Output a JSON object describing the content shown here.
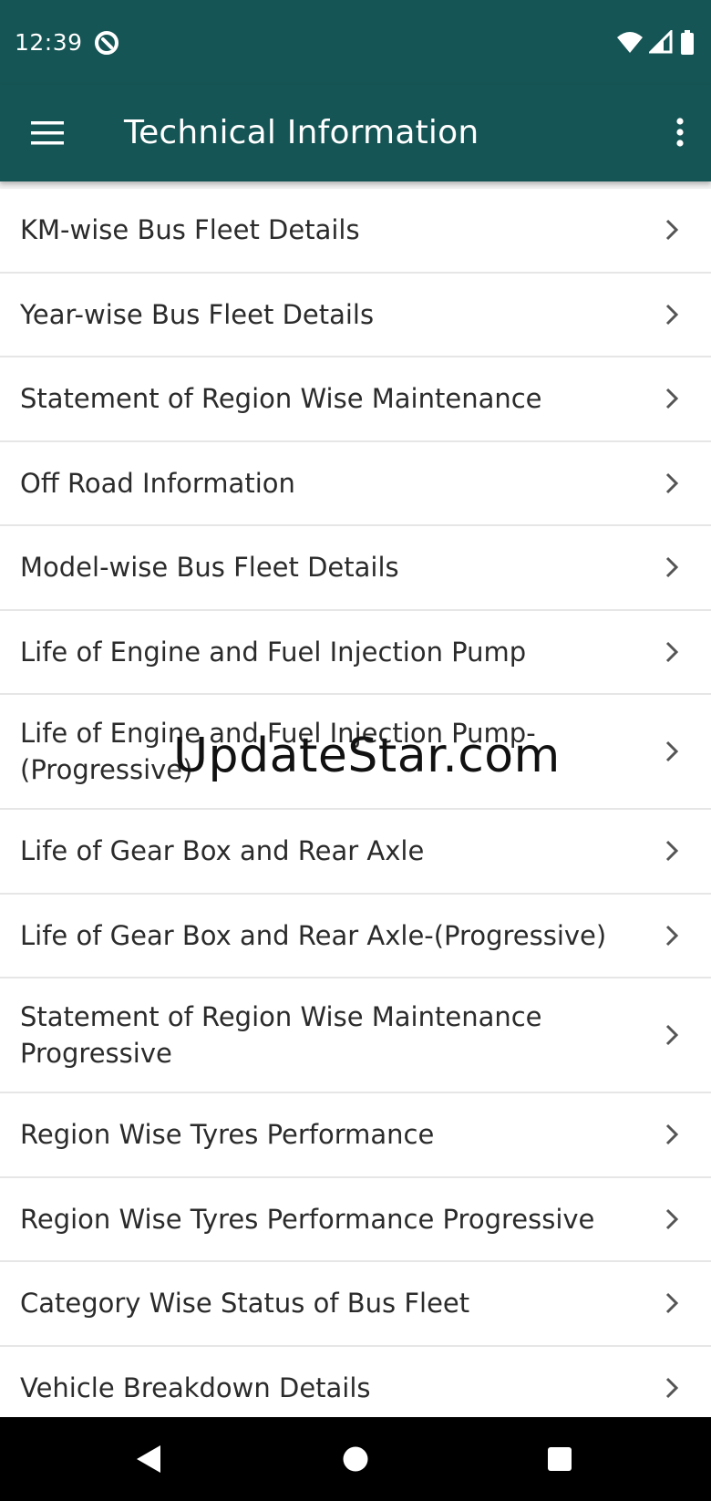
{
  "status_bar": {
    "time": "12:39",
    "app_icon": "app-notification-icon",
    "icons": [
      "wifi-icon",
      "cell-signal-icon",
      "battery-icon"
    ]
  },
  "app_bar": {
    "title": "Technical Information",
    "menu_icon": "hamburger-menu-icon",
    "overflow_icon": "more-vert-icon",
    "background_color": "#165555"
  },
  "list": {
    "items": [
      {
        "label": "KM-wise Bus Fleet Details"
      },
      {
        "label": "Year-wise Bus Fleet Details"
      },
      {
        "label": "Statement of Region Wise Maintenance"
      },
      {
        "label": "Off Road Information"
      },
      {
        "label": "Model-wise Bus Fleet Details"
      },
      {
        "label": "Life of Engine and Fuel Injection Pump"
      },
      {
        "label": "Life of Engine and Fuel Injection Pump-\n(Progressive)"
      },
      {
        "label": "Life of Gear Box and Rear Axle"
      },
      {
        "label": "Life of Gear Box and Rear Axle-(Progressive)"
      },
      {
        "label": "Statement of Region Wise Maintenance\nProgressive"
      },
      {
        "label": "Region Wise Tyres Performance"
      },
      {
        "label": "Region Wise Tyres Performance Progressive"
      },
      {
        "label": "Category Wise Status of Bus Fleet"
      },
      {
        "label": "Vehicle Breakdown Details"
      }
    ],
    "chevron_icon": "chevron-right-icon"
  },
  "watermark": {
    "text": "UpdateStar.com"
  },
  "nav_bar": {
    "icons": [
      "nav-back-icon",
      "nav-home-icon",
      "nav-recents-icon"
    ]
  }
}
